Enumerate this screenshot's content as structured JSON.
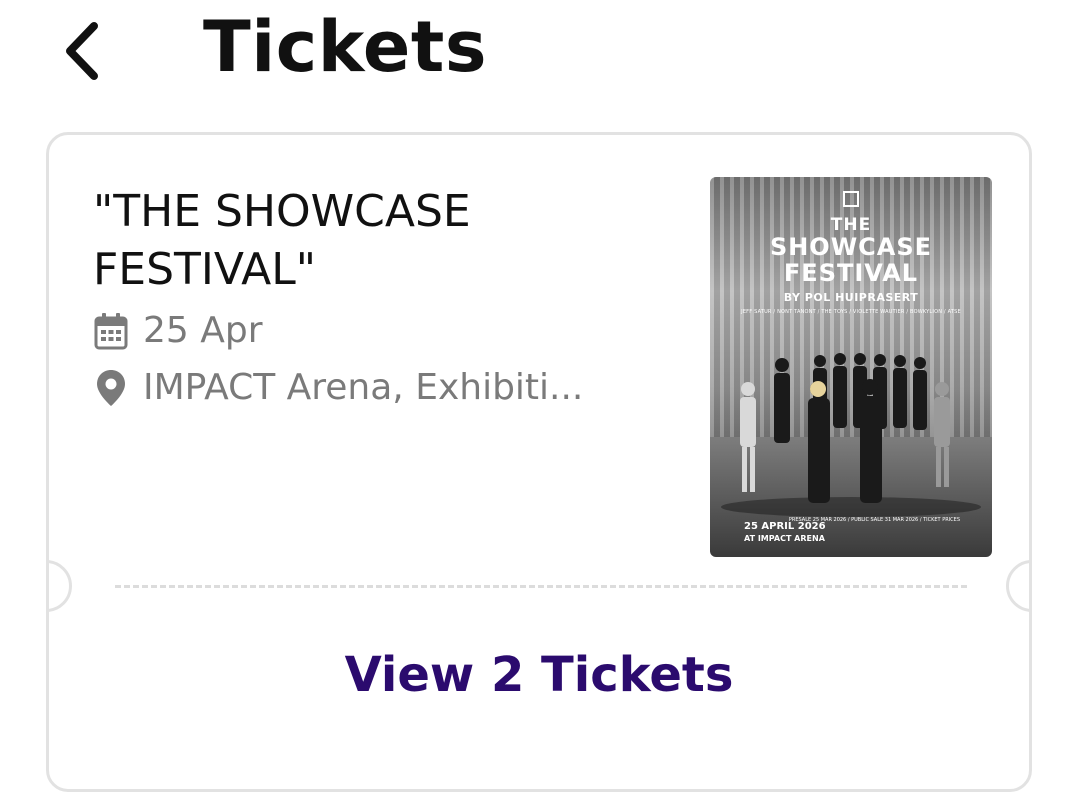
{
  "header": {
    "back_icon": "chevron-left-icon",
    "title": "Tickets"
  },
  "ticket": {
    "title": "\"THE SHOWCASE FESTIVAL\"",
    "date": "25 Apr",
    "date_icon": "calendar-icon",
    "venue": "IMPACT Arena, Exhibiti...",
    "venue_icon": "location-pin-icon",
    "poster": {
      "the": "THE",
      "title_line1": "SHOWCASE",
      "title_line2": "FESTIVAL",
      "by": "BY POL HUIPRASERT",
      "lineup": "JEFF SATUR / NONT TANONT / THE TOYS / VIOLETTE WAUTIER / BOWKYLION / ATSE",
      "date": "25 APRIL 2026",
      "venue": "AT IMPACT ARENA",
      "sale_info": "PRESALE 25 MAR 2026 / PUBLIC SALE 31 MAR 2026 / TICKET PRICES"
    },
    "view_button": "View 2 Tickets"
  },
  "colors": {
    "accent": "#2b0b6e",
    "muted_text": "#7a7a7a",
    "border": "#e2e2e2"
  }
}
